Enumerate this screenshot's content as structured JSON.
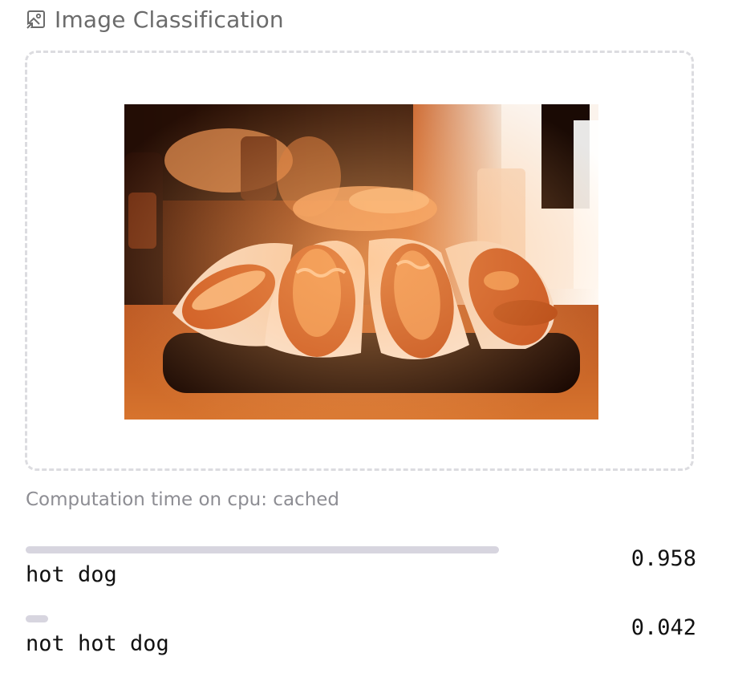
{
  "header": {
    "icon": "image-icon",
    "title": "Image Classification"
  },
  "input_image": {
    "description_icon": "hot-dog-photo"
  },
  "computation": {
    "text": "Computation time on cpu: cached"
  },
  "predictions": [
    {
      "label": "hot dog",
      "score_text": "0.958",
      "score": 0.958
    },
    {
      "label": "not hot dog",
      "score_text": "0.042",
      "score": 0.042
    }
  ],
  "colors": {
    "bar": "#d7d5df",
    "header_text": "#6b6b6b",
    "muted_text": "#8d8d93",
    "dropzone_border": "#dcdce0"
  }
}
